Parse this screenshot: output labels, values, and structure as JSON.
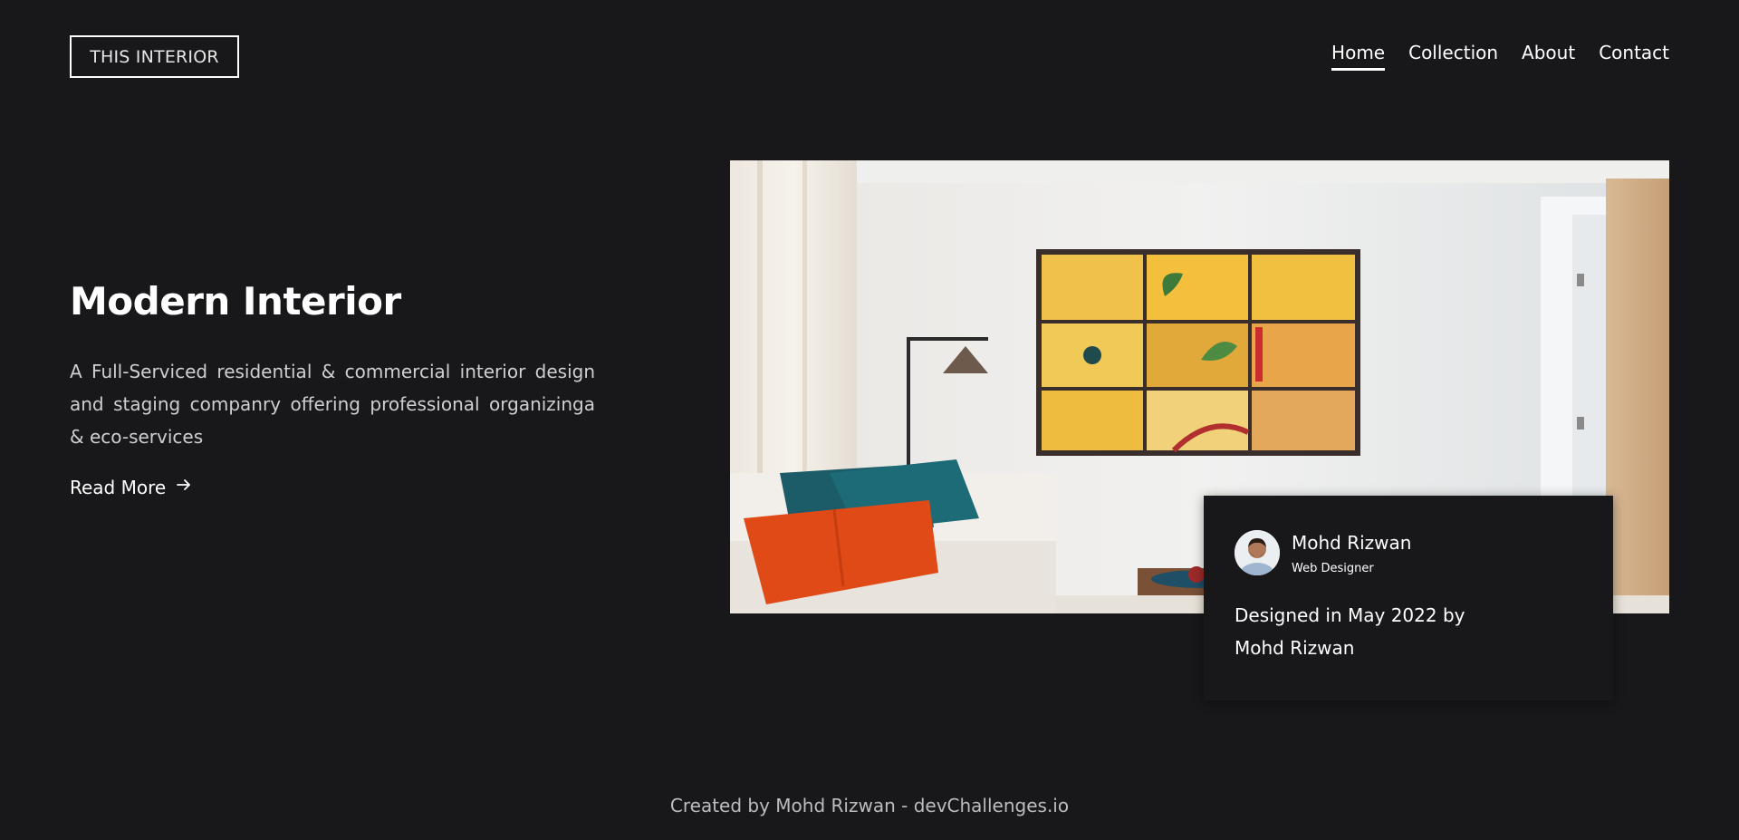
{
  "header": {
    "logo": "THIS INTERIOR",
    "nav": [
      {
        "label": "Home",
        "active": true
      },
      {
        "label": "Collection",
        "active": false
      },
      {
        "label": "About",
        "active": false
      },
      {
        "label": "Contact",
        "active": false
      }
    ]
  },
  "hero": {
    "title": "Modern Interior",
    "description": "A Full-Serviced residential & commercial interior design and staging companry offering professional organizinga & eco-services",
    "cta_label": "Read More",
    "cta_icon": "arrow-right-icon",
    "image_description": "living-room-photo"
  },
  "card": {
    "name": "Mohd Rizwan",
    "role": "Web Designer",
    "text": "Designed in May 2022 by Mohd Rizwan"
  },
  "footer": {
    "text": "Created by Mohd Rizwan - devChallenges.io"
  },
  "colors": {
    "background": "#18181b",
    "text": "#ffffff",
    "muted": "#cfcfcf"
  }
}
